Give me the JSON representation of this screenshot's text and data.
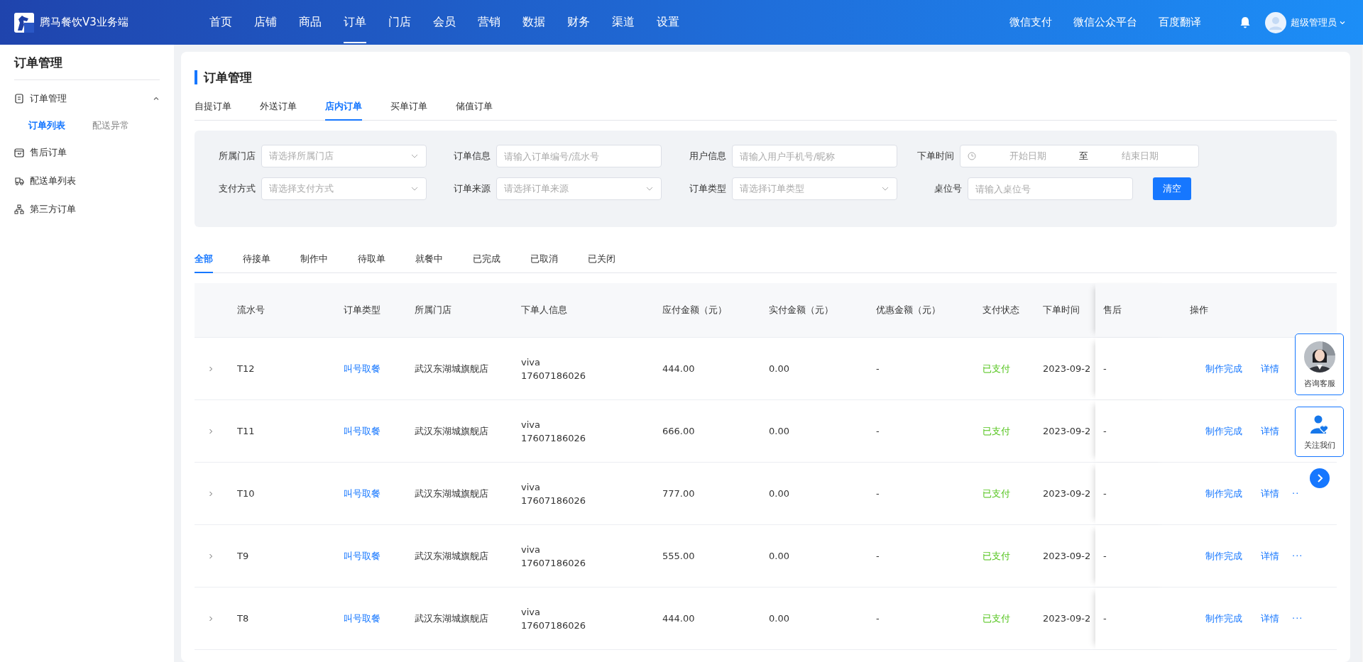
{
  "brand": {
    "name": "腾马餐饮V3业务端"
  },
  "nav": [
    {
      "label": "首页",
      "selected": false
    },
    {
      "label": "店铺",
      "selected": false
    },
    {
      "label": "商品",
      "selected": false
    },
    {
      "label": "订单",
      "selected": true
    },
    {
      "label": "门店",
      "selected": false
    },
    {
      "label": "会员",
      "selected": false
    },
    {
      "label": "营销",
      "selected": false
    },
    {
      "label": "数据",
      "selected": false
    },
    {
      "label": "财务",
      "selected": false
    },
    {
      "label": "渠道",
      "selected": false
    },
    {
      "label": "设置",
      "selected": false
    }
  ],
  "top_links": [
    "微信支付",
    "微信公众平台",
    "百度翻译"
  ],
  "user": {
    "name": "超级管理员"
  },
  "sidebar": {
    "title": "订单管理",
    "items": [
      {
        "label": "订单管理",
        "kind": "doc",
        "expanded": true,
        "children": [
          {
            "label": "订单列表",
            "selected": true
          },
          {
            "label": "配送异常",
            "selected": false
          }
        ]
      },
      {
        "label": "售后订单",
        "kind": "return"
      },
      {
        "label": "配送单列表",
        "kind": "delivery"
      },
      {
        "label": "第三方订单",
        "kind": "tree"
      }
    ]
  },
  "page": {
    "title": "订单管理",
    "type_tabs": [
      {
        "label": "自提订单",
        "selected": false
      },
      {
        "label": "外送订单",
        "selected": false
      },
      {
        "label": "店内订单",
        "selected": true
      },
      {
        "label": "买单订单",
        "selected": false
      },
      {
        "label": "储值订单",
        "selected": false
      }
    ],
    "filters": [
      {
        "label": "所属门店",
        "kind": "select",
        "placeholder": "请选择所属门店"
      },
      {
        "label": "订单信息",
        "kind": "input",
        "placeholder": "请输入订单编号/流水号"
      },
      {
        "label": "用户信息",
        "kind": "input",
        "placeholder": "请输入用户手机号/昵称"
      },
      {
        "label": "下单时间",
        "kind": "daterange",
        "start_placeholder": "开始日期",
        "separator": "至",
        "end_placeholder": "结束日期"
      },
      {
        "label": "支付方式",
        "kind": "select",
        "placeholder": "请选择支付方式"
      },
      {
        "label": "订单来源",
        "kind": "select",
        "placeholder": "请选择订单来源"
      },
      {
        "label": "订单类型",
        "kind": "select",
        "placeholder": "请选择订单类型"
      },
      {
        "label": "桌位号",
        "kind": "input",
        "placeholder": "请输入桌位号"
      }
    ],
    "clear_button": "清空",
    "status_tabs": [
      {
        "label": "全部",
        "selected": true
      },
      {
        "label": "待接单",
        "selected": false
      },
      {
        "label": "制作中",
        "selected": false
      },
      {
        "label": "待取单",
        "selected": false
      },
      {
        "label": "就餐中",
        "selected": false
      },
      {
        "label": "已完成",
        "selected": false
      },
      {
        "label": "已取消",
        "selected": false
      },
      {
        "label": "已关闭",
        "selected": false
      }
    ]
  },
  "table": {
    "columns": [
      "流水号",
      "订单类型",
      "所属门店",
      "下单人信息",
      "应付金额（元）",
      "实付金额（元）",
      "优惠金额（元）",
      "支付状态",
      "下单时间",
      "售后",
      "操作"
    ],
    "rows": [
      {
        "serial": "T12",
        "order_type": "叫号取餐",
        "store": "武汉东湖城旗舰店",
        "user_name": "viva",
        "user_phone": "17607186026",
        "payable": "444.00",
        "paid": "0.00",
        "discount": "-",
        "pay_status": "已支付",
        "time": "2023-09-2",
        "after_sale": "-",
        "actions": [
          "制作完成",
          "详情"
        ]
      },
      {
        "serial": "T11",
        "order_type": "叫号取餐",
        "store": "武汉东湖城旗舰店",
        "user_name": "viva",
        "user_phone": "17607186026",
        "payable": "666.00",
        "paid": "0.00",
        "discount": "-",
        "pay_status": "已支付",
        "time": "2023-09-2",
        "after_sale": "-",
        "actions": [
          "制作完成",
          "详情"
        ]
      },
      {
        "serial": "T10",
        "order_type": "叫号取餐",
        "store": "武汉东湖城旗舰店",
        "user_name": "viva",
        "user_phone": "17607186026",
        "payable": "777.00",
        "paid": "0.00",
        "discount": "-",
        "pay_status": "已支付",
        "time": "2023-09-2",
        "after_sale": "-",
        "actions": [
          "制作完成",
          "详情"
        ],
        "more": "··"
      },
      {
        "serial": "T9",
        "order_type": "叫号取餐",
        "store": "武汉东湖城旗舰店",
        "user_name": "viva",
        "user_phone": "17607186026",
        "payable": "555.00",
        "paid": "0.00",
        "discount": "-",
        "pay_status": "已支付",
        "time": "2023-09-2",
        "after_sale": "-",
        "actions": [
          "制作完成",
          "详情"
        ],
        "more": "···"
      },
      {
        "serial": "T8",
        "order_type": "叫号取餐",
        "store": "武汉东湖城旗舰店",
        "user_name": "viva",
        "user_phone": "17607186026",
        "payable": "444.00",
        "paid": "0.00",
        "discount": "-",
        "pay_status": "已支付",
        "time": "2023-09-2",
        "after_sale": "-",
        "actions": [
          "制作完成",
          "详情"
        ],
        "more": "···"
      }
    ]
  },
  "float_panel": {
    "items": [
      {
        "kind": "picture",
        "label": "咨询客服"
      },
      {
        "kind": "follow",
        "label": "关注我们"
      }
    ]
  }
}
